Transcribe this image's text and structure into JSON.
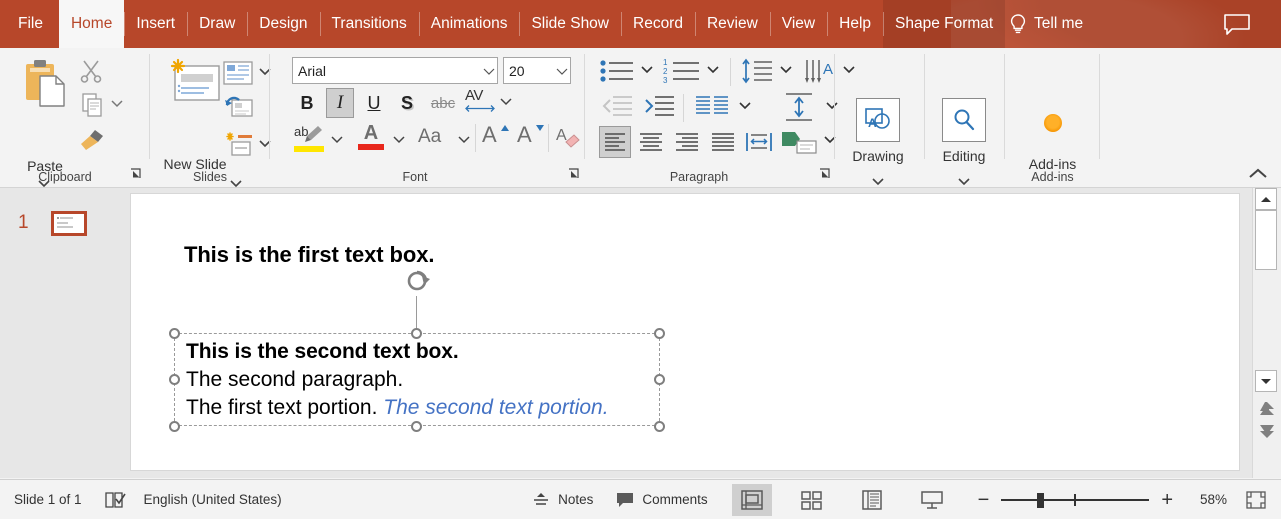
{
  "app": {
    "accent_color": "#b7472a",
    "tab_active_bg": "#f7f7f7",
    "ribbon_bg": "#f3f3f3",
    "accent_text_color": "#4472c4"
  },
  "tabs": [
    {
      "label": "File",
      "state": "normal"
    },
    {
      "label": "Home",
      "state": "active"
    },
    {
      "label": "Insert",
      "state": "normal"
    },
    {
      "label": "Draw",
      "state": "normal"
    },
    {
      "label": "Design",
      "state": "normal"
    },
    {
      "label": "Transitions",
      "state": "normal"
    },
    {
      "label": "Animations",
      "state": "normal"
    },
    {
      "label": "Slide Show",
      "state": "normal"
    },
    {
      "label": "Record",
      "state": "normal"
    },
    {
      "label": "Review",
      "state": "normal"
    },
    {
      "label": "View",
      "state": "normal"
    },
    {
      "label": "Help",
      "state": "normal"
    },
    {
      "label": "Shape Format",
      "state": "contextual"
    }
  ],
  "titlebar": {
    "tell_me_label": "Tell me",
    "tell_me_icon": "lightbulb-icon",
    "comments_icon": "comment-icon"
  },
  "ribbon": {
    "groups": [
      {
        "name": "clipboard",
        "label": "Clipboard"
      },
      {
        "name": "slides",
        "label": "Slides"
      },
      {
        "name": "font",
        "label": "Font"
      },
      {
        "name": "paragraph",
        "label": "Paragraph"
      },
      {
        "name": "drawing",
        "label": "Drawing"
      },
      {
        "name": "editing",
        "label": "Editing"
      },
      {
        "name": "addins",
        "label": "Add-ins"
      }
    ],
    "clipboard": {
      "paste_label": "Paste",
      "cut_icon": "scissors-icon",
      "copy_icon": "copy-icon",
      "format_painter_icon": "format-painter-icon",
      "paste_icon": "paste-icon"
    },
    "slides": {
      "new_slide_label": "New Slide",
      "layout_icon": "slide-layout-icon",
      "reset_icon": "slide-reset-icon",
      "section_icon": "slide-section-icon"
    },
    "font": {
      "font_family_value": "Arial",
      "font_size_value": "20",
      "bold_label": "B",
      "italic_label": "I",
      "italic_state": "active",
      "underline_label": "U",
      "shadow_label": "S",
      "strikethrough_label": "abc",
      "char_spacing_label": "AV",
      "text_highlight_icon": "text-highlight-icon",
      "font_color_label": "A",
      "change_case_label": "Aa",
      "increase_size_label": "A",
      "decrease_size_label": "A",
      "clear_formatting_icon": "clear-formatting-icon"
    },
    "paragraph": {
      "bullets_icon": "bullet-list-icon",
      "numbering_icon": "numbered-list-icon",
      "line_spacing_icon": "line-spacing-icon",
      "text_direction_icon": "text-direction-icon",
      "decrease_indent_icon": "decrease-indent-icon",
      "increase_indent_icon": "increase-indent-icon",
      "columns_icon": "columns-icon",
      "align_text_icon": "align-text-vertical-icon",
      "align_left_icon": "align-left-icon",
      "align_left_state": "active",
      "align_center_icon": "align-center-icon",
      "align_right_icon": "align-right-icon",
      "justify_icon": "justify-icon",
      "distributed_icon": "distributed-icon",
      "smartart_icon": "convert-to-smartart-icon"
    },
    "drawing": {
      "label": "Drawing",
      "icon": "drawing-shapes-icon"
    },
    "editing": {
      "label": "Editing",
      "icon": "search-icon"
    },
    "addins": {
      "label": "Add-ins",
      "icon": "addins-dot-icon"
    },
    "collapse_icon": "collapse-ribbon-icon"
  },
  "thumbnails": {
    "slides": [
      {
        "number": "1",
        "selected": true
      }
    ]
  },
  "slide_canvas": {
    "text_boxes": [
      {
        "name": "first-text-box",
        "selected": false,
        "lines": [
          {
            "runs": [
              {
                "text": "This is the first text box.",
                "bold": true,
                "italic": false,
                "color": "#000000"
              }
            ]
          }
        ]
      },
      {
        "name": "second-text-box",
        "selected": true,
        "lines": [
          {
            "runs": [
              {
                "text": "This is the second text box.",
                "bold": true,
                "italic": false,
                "color": "#000000"
              }
            ]
          },
          {
            "runs": [
              {
                "text": "The second paragraph.",
                "bold": false,
                "italic": false,
                "color": "#000000"
              }
            ]
          },
          {
            "runs": [
              {
                "text": "The first text portion. ",
                "bold": false,
                "italic": false,
                "color": "#000000"
              },
              {
                "text": "The second text portion.",
                "bold": false,
                "italic": true,
                "color": "#4472c4"
              }
            ]
          }
        ]
      }
    ],
    "text": {
      "first_box_line1": "This is the first text box.",
      "second_box_line1": "This is the second text box.",
      "second_box_line2": "The second paragraph.",
      "second_box_line3a": "The first text portion. ",
      "second_box_line3b": "The second text portion."
    },
    "rotation_handle_icon": "rotate-handle-icon"
  },
  "scrollbar": {
    "up_icon": "scroll-up-icon",
    "down_icon": "scroll-down-icon",
    "previous_slide_icon": "previous-slide-icon",
    "next_slide_icon": "next-slide-icon"
  },
  "status_bar": {
    "slide_indicator": "Slide 1 of 1",
    "accessibility_icon": "accessibility-check-icon",
    "language": "English (United States)",
    "notes_label": "Notes",
    "notes_icon": "notes-icon",
    "comments_label": "Comments",
    "comments_icon": "comment-icon",
    "views": [
      {
        "name": "normal-view",
        "icon": "normal-view-icon",
        "active": true
      },
      {
        "name": "slide-sorter-view",
        "icon": "slide-sorter-icon",
        "active": false
      },
      {
        "name": "reading-view",
        "icon": "reading-view-icon",
        "active": false
      },
      {
        "name": "slide-show-view",
        "icon": "slide-show-icon",
        "active": false
      }
    ],
    "zoom_out_label": "−",
    "zoom_in_label": "+",
    "zoom_value": "58%",
    "fit_slide_icon": "fit-slide-to-window-icon"
  }
}
